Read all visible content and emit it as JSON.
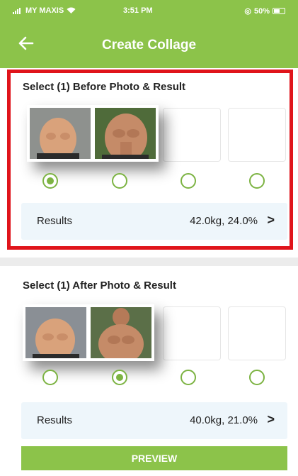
{
  "status_bar": {
    "carrier": "MY MAXIS",
    "time": "3:51 PM",
    "battery": "50%"
  },
  "header": {
    "title": "Create Collage",
    "back_icon": "arrow-left-icon"
  },
  "before_section": {
    "title": "Select (1) Before Photo & Result",
    "radios": [
      true,
      false,
      false,
      false
    ],
    "results_label": "Results",
    "results_value": "42.0kg, 24.0%",
    "chevron": ">"
  },
  "after_section": {
    "title": "Select (1) After Photo & Result",
    "radios": [
      false,
      true,
      false,
      false
    ],
    "results_label": "Results",
    "results_value": "40.0kg, 21.0%",
    "chevron": ">"
  },
  "preview_button": "PREVIEW",
  "colors": {
    "brand_green": "#8cc34a",
    "highlight_red": "#e0141b",
    "results_bg": "#eef6fb"
  }
}
